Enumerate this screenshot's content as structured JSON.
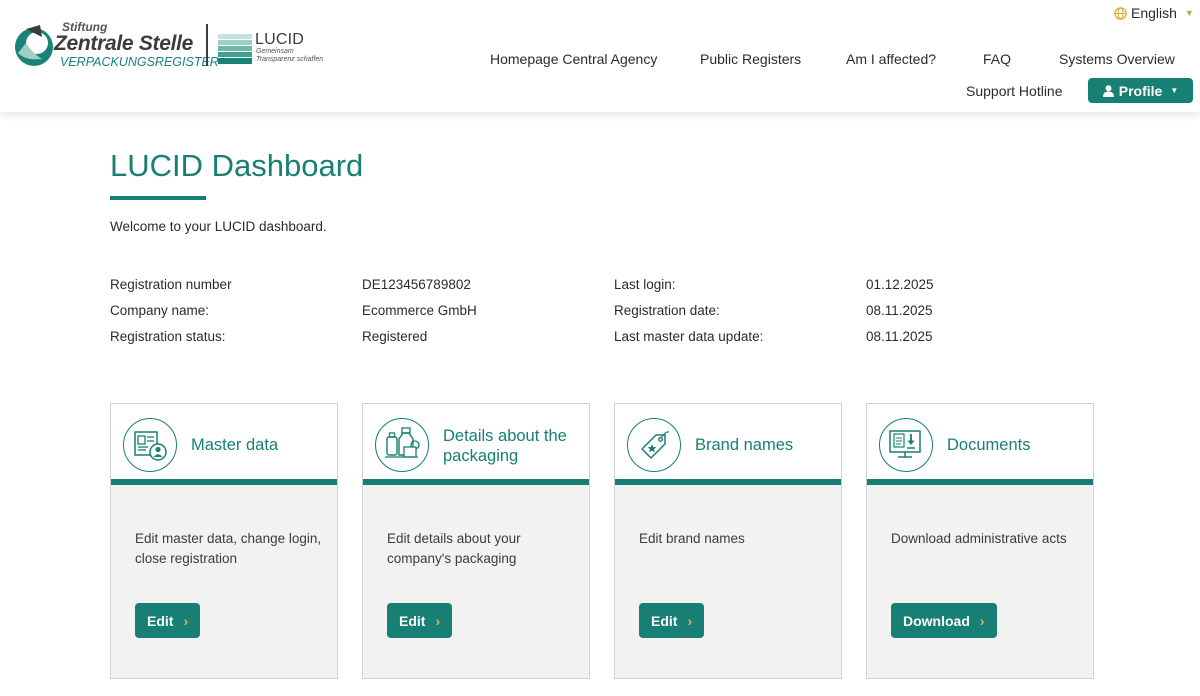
{
  "header": {
    "logo_zs": {
      "line1": "Stiftung",
      "line2": "Zentrale Stelle",
      "line3": "VERPACKUNGSREGISTER"
    },
    "logo_lucid": {
      "name": "LUCID",
      "tag1": "Gemeinsam",
      "tag2": "Transparenz schaffen"
    },
    "language": "English",
    "nav": [
      "Homepage Central Agency",
      "Public Registers",
      "Am I affected?",
      "FAQ",
      "Systems Overview",
      "Support Hotline"
    ],
    "profile_label": "Profile"
  },
  "main": {
    "title": "LUCID Dashboard",
    "welcome": "Welcome to your LUCID dashboard.",
    "info_left": [
      {
        "label": "Registration number",
        "value": "DE123456789802"
      },
      {
        "label": "Company name:",
        "value": "Ecommerce GmbH"
      },
      {
        "label": "Registration status:",
        "value": "Registered"
      }
    ],
    "info_right": [
      {
        "label": "Last login:",
        "value": "01.12.2025"
      },
      {
        "label": "Registration date:",
        "value": "08.11.2025"
      },
      {
        "label": "Last master data update:",
        "value": "08.11.2025"
      }
    ],
    "cards": [
      {
        "title": "Master data",
        "desc": "Edit master data, change login, close registration",
        "button": "Edit",
        "icon": "master-data-icon"
      },
      {
        "title": "Details about the packaging",
        "desc": "Edit details about your company's packaging",
        "button": "Edit",
        "icon": "packaging-icon"
      },
      {
        "title": "Brand names",
        "desc": "Edit brand names",
        "button": "Edit",
        "icon": "brand-tag-icon"
      },
      {
        "title": "Documents",
        "desc": "Download administrative acts",
        "button": "Download",
        "icon": "documents-icon"
      }
    ]
  },
  "colors": {
    "brand": "#177f73",
    "accent": "#e0b44a"
  }
}
